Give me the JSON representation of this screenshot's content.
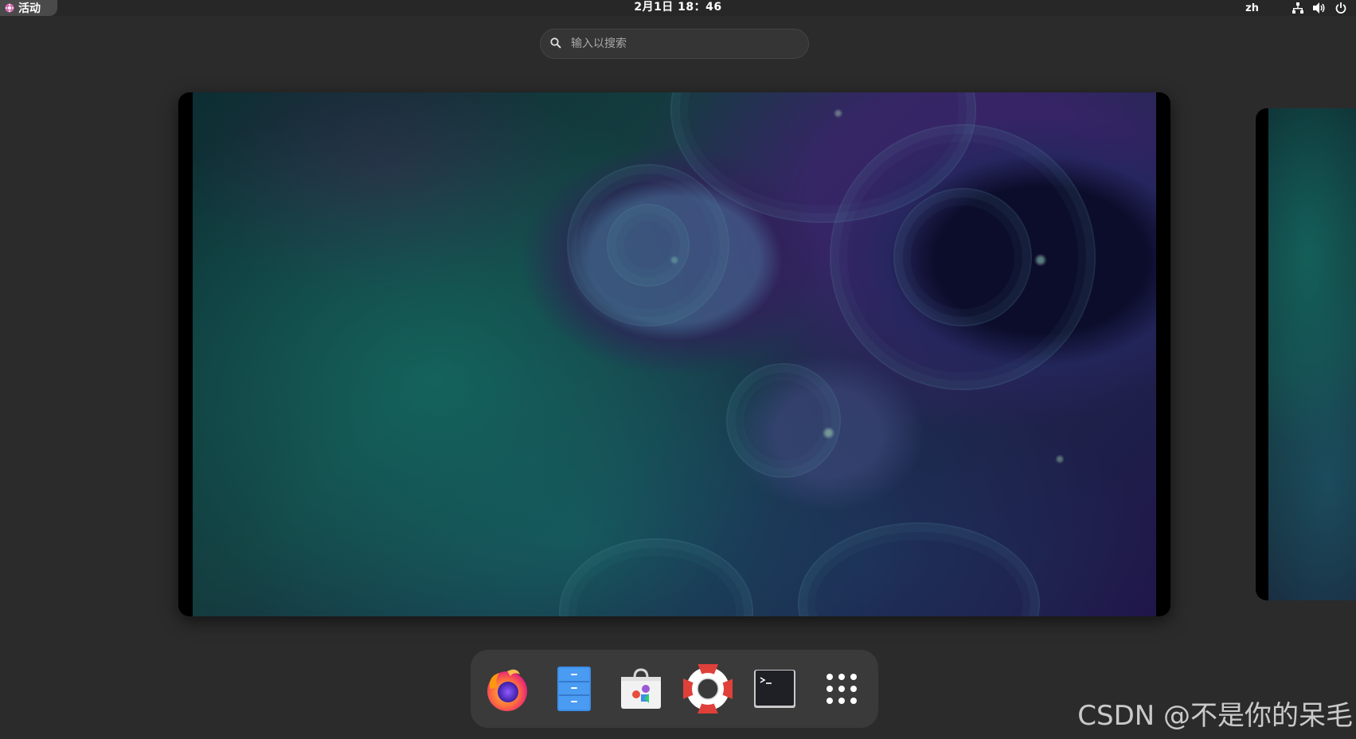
{
  "topbar": {
    "activities_label": "活动",
    "clock": "2月1日 18：46",
    "language": "zh",
    "icons": [
      "network-icon",
      "volume-icon",
      "power-icon"
    ]
  },
  "search": {
    "placeholder": "输入以搜索",
    "value": ""
  },
  "dash": {
    "apps": [
      {
        "name": "firefox",
        "icon": "firefox-icon"
      },
      {
        "name": "files",
        "icon": "files-icon"
      },
      {
        "name": "software",
        "icon": "software-icon"
      },
      {
        "name": "help",
        "icon": "help-icon"
      },
      {
        "name": "terminal",
        "icon": "terminal-icon"
      },
      {
        "name": "show-applications",
        "icon": "app-grid-icon"
      }
    ]
  },
  "watermark": "CSDN @不是你的呆毛",
  "colors": {
    "background": "#2b2b2b",
    "topbar": "#272727",
    "dash": "#3a3a3a",
    "search": "#353535"
  }
}
